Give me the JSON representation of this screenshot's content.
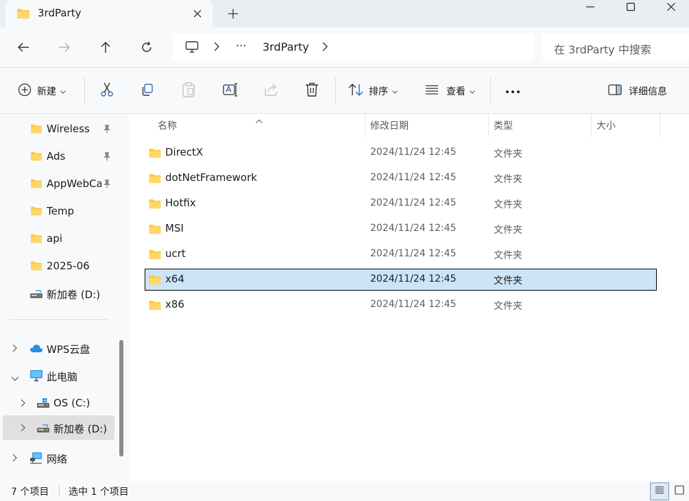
{
  "tab": {
    "title": "3rdParty"
  },
  "address": {
    "ellipsis": "···",
    "current": "3rdParty"
  },
  "search": {
    "placeholder": "在 3rdParty 中搜索"
  },
  "toolbar": {
    "new_label": "新建",
    "sort_label": "排序",
    "view_label": "查看",
    "details_label": "详细信息"
  },
  "sidebar": {
    "quick": [
      {
        "label": "Wireless",
        "pinned": true
      },
      {
        "label": "Ads",
        "pinned": true
      },
      {
        "label": "AppWebCa",
        "pinned": true
      },
      {
        "label": "Temp",
        "pinned": false
      },
      {
        "label": "api",
        "pinned": false
      },
      {
        "label": "2025-06",
        "pinned": false
      },
      {
        "label": "新加卷 (D:)",
        "pinned": false
      }
    ],
    "tree": [
      {
        "label": "WPS云盘"
      },
      {
        "label": "此电脑"
      },
      {
        "label": "OS (C:)"
      },
      {
        "label": "新加卷 (D:)"
      },
      {
        "label": "网络"
      }
    ]
  },
  "columns": {
    "name": "名称",
    "modified": "修改日期",
    "type": "类型",
    "size": "大小"
  },
  "files": [
    {
      "name": "DirectX",
      "modified": "2024/11/24 12:45",
      "type": "文件夹"
    },
    {
      "name": "dotNetFramework",
      "modified": "2024/11/24 12:45",
      "type": "文件夹"
    },
    {
      "name": "Hotfix",
      "modified": "2024/11/24 12:45",
      "type": "文件夹"
    },
    {
      "name": "MSI",
      "modified": "2024/11/24 12:45",
      "type": "文件夹"
    },
    {
      "name": "ucrt",
      "modified": "2024/11/24 12:45",
      "type": "文件夹"
    },
    {
      "name": "x64",
      "modified": "2024/11/24 12:45",
      "type": "文件夹"
    },
    {
      "name": "x86",
      "modified": "2024/11/24 12:45",
      "type": "文件夹"
    }
  ],
  "status": {
    "count": "7 个项目",
    "selected": "选中 1 个项目"
  },
  "colors": {
    "accent": "#0067c0",
    "selection": "#cce4f7",
    "folder": "#ffc83d"
  }
}
